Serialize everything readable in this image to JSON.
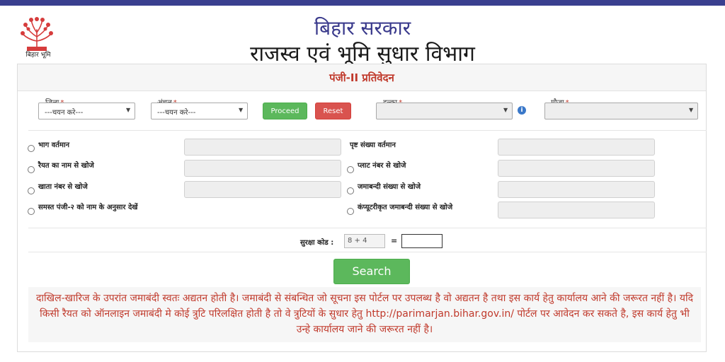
{
  "header": {
    "logo_text": "बिहार भूमि",
    "gov_title": "बिहार सरकार",
    "dept_title": "राजस्व एवं भूमि सुधार विभाग"
  },
  "page": {
    "title": "पंजी-II प्रतिवेदन"
  },
  "filters": {
    "district": {
      "label": "जिला",
      "required": "*",
      "value": "---चयन करे---"
    },
    "circle": {
      "label": "अंचल",
      "required": "*",
      "value": "---चयन करे---"
    },
    "proceed_label": "Proceed",
    "reset_label": "Reset",
    "halka": {
      "label": "हल्का",
      "required": "*",
      "value": ""
    },
    "info_glyph": "i",
    "mauza": {
      "label": "मौजा",
      "required": "*",
      "value": ""
    }
  },
  "search_options": {
    "left": [
      {
        "label": "भाग वर्तमान",
        "value": ""
      },
      {
        "label": "रैयत का नाम से खोजे",
        "value": ""
      },
      {
        "label": "खाता नंबर से खोजे",
        "value": ""
      },
      {
        "label": "समस्त पंजी-२ को नाम के अनुसार देखें"
      }
    ],
    "right": [
      {
        "label": "पृष्ट संख्या वर्तमान",
        "value": ""
      },
      {
        "label": "प्लाट नंबर से खोजे",
        "value": ""
      },
      {
        "label": "जमाबन्दी संख्या से खोजे",
        "value": ""
      },
      {
        "label": "कंप्यूटरीकृत जमाबन्दी संख्या से खोजे",
        "value": ""
      }
    ]
  },
  "captcha": {
    "label": "सुरक्षा कोड :",
    "expression": "8 + 4",
    "equals": "=",
    "answer": ""
  },
  "search_label": "Search",
  "notice": "दाखिल-खारिज के उपरांत जमाबंदी स्वतः अद्यतन होती है। जमाबंदी से संबन्धित जो सूचना इस पोर्टल पर उपलब्ध है वो अद्यतन है तथा इस कार्य हेतु कार्यालय आने की जरूरत नहीं है। यदि किसी रैयत को ऑनलाइन जमाबंदी मे कोई त्रुटि परिलक्षित होती है तो वे त्रुटियों के सुधार हेतु http://parimarjan.bihar.gov.in/ पोर्टल पर आवेदन कर सकते है, इस कार्य हेतु भी उन्हे कार्यालय जाने की जरूरत नहीं है।",
  "colors": {
    "accent_red": "#c0392b",
    "topbar": "#3a3f8f",
    "button_green": "#5cb85c",
    "button_red": "#d9534f"
  }
}
